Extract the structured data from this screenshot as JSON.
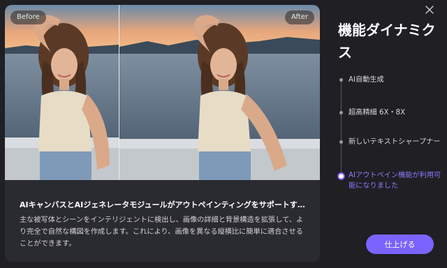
{
  "preview": {
    "before_label": "Before",
    "after_label": "After"
  },
  "feature": {
    "headline": "AIキャンバスとAIジェネレータモジュールがアウトペインティングをサポートす…",
    "description": "主な被写体とシーンをインテリジェントに検出し、画像の詳細と背景構造を拡張して、より完全で自然な構図を作成します。これにより、画像を異なる縦横比に簡単に適合させることができます。"
  },
  "panel": {
    "title": "機能ダイナミクス",
    "items": [
      {
        "label": "AI自動生成",
        "active": false
      },
      {
        "label": "超高精細 6X・8X",
        "active": false
      },
      {
        "label": "新しいテキストシャープナー",
        "active": false
      },
      {
        "label": "AIアウトペイン機能が利用可能になりました",
        "active": true
      }
    ],
    "finish_label": "仕上げる"
  },
  "colors": {
    "accent": "#7a63ff",
    "active_text": "#8c7cff",
    "background": "#1f1f24",
    "card": "#2a2a31"
  },
  "icons": {
    "close": "close-icon"
  }
}
